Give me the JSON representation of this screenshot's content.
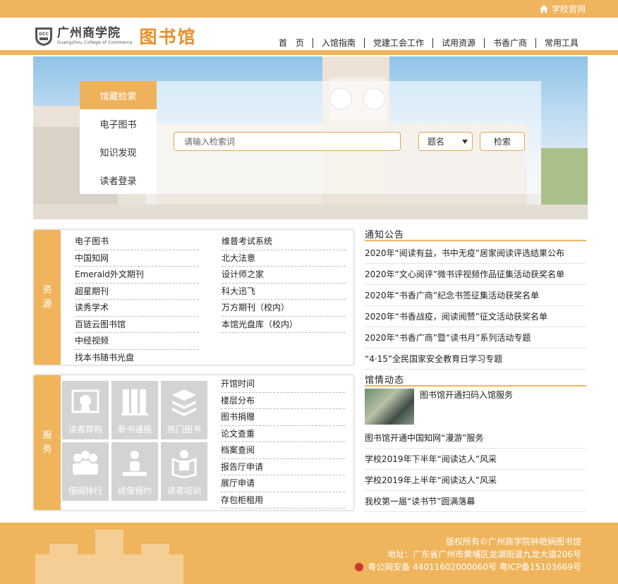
{
  "topbar": {
    "home_label": "学校官网",
    "home_icon": "home-icon"
  },
  "logo": {
    "seal_text": "GCC",
    "college_cn": "广州商学院",
    "college_en": "Guangzhou College of Commerce",
    "library": "图书馆"
  },
  "nav": [
    "首　页",
    "入馆指南",
    "党建工会工作",
    "试用资源",
    "书香广商",
    "常用工具"
  ],
  "search": {
    "tabs": [
      "馆藏检索",
      "电子图书",
      "知识发现",
      "读者登录"
    ],
    "placeholder": "请输入检索词",
    "field": "题名",
    "button": "检索"
  },
  "resources": {
    "side_label": [
      "资",
      "源"
    ],
    "col1": [
      "电子图书",
      "中国知网",
      "Emerald外文期刊",
      "超星期刊",
      "读秀学术",
      "百链云图书馆",
      "中经视频",
      "找本书随书光盘"
    ],
    "col2": [
      "维普考试系统",
      "北大法意",
      "设计师之家",
      "科大迅飞",
      "万方期刊（校内）",
      "本馆光盘库（校内）"
    ]
  },
  "services": {
    "side_label": [
      "服",
      "务"
    ],
    "tiles": [
      {
        "label": "读者荐购",
        "icon": "recommend-icon"
      },
      {
        "label": "新书通报",
        "icon": "new-books-icon"
      },
      {
        "label": "热门图书",
        "icon": "hot-books-icon"
      },
      {
        "label": "借阅排行",
        "icon": "ranking-icon"
      },
      {
        "label": "续借预约",
        "icon": "renew-icon"
      },
      {
        "label": "读者培训",
        "icon": "training-icon"
      }
    ],
    "links": [
      "开馆时间",
      "楼层分布",
      "图书捐赠",
      "论文查重",
      "档案查阅",
      "报告厅申请",
      "展厅申请",
      "存包柜租用"
    ]
  },
  "notices": {
    "heading": "通知公告",
    "items": [
      "2020年“阅读有益，书中无疫”居家阅读评选结果公布",
      "2020年“文心阅评”微书评视频作品征集活动获奖名单",
      "2020年“书香广商”纪念书签征集活动获奖名单",
      "2020年“书香战疫，阅读阅赞”征文活动获奖名单",
      "2020年“书香广商”暨“读书月”系列活动专题",
      "“4·15”全民国家安全教育日学习专题"
    ]
  },
  "news": {
    "heading": "馆情动态",
    "feature": "图书馆开通扫码入馆服务",
    "items": [
      "图书馆开通中国知网“漫游”服务",
      "学校2019年下半年“阅读达人”风采",
      "学校2019年上半年“阅读达人”风采",
      "我校第一届“读书节”圆满落幕"
    ]
  },
  "footer": {
    "copyright": "版权所有©广州商学院钟艳娴图书馆",
    "address": "地址：广东省广州市黄埔区龙湖街道九龙大道206号",
    "icp": "粤公网安备 44011602000060号 粤ICP备15103669号"
  },
  "colors": {
    "accent": "#f0b45c",
    "tile": "#d3d3d3"
  }
}
